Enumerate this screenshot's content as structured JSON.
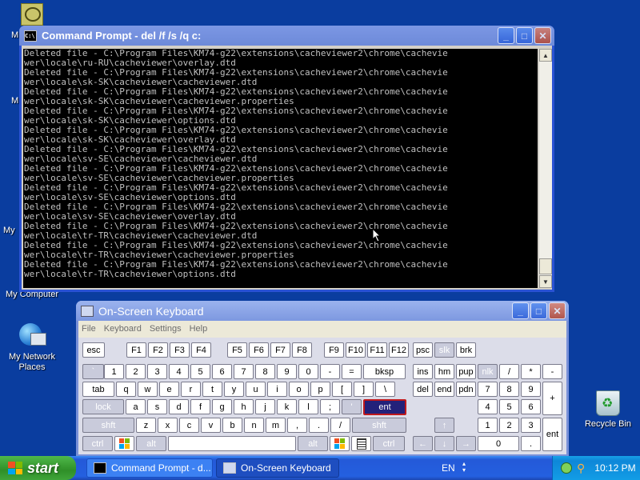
{
  "desktop": {
    "icons": [
      {
        "label": "My Computer"
      },
      {
        "label": "My Network Places"
      },
      {
        "label": "Recycle Bin"
      }
    ],
    "partial_label_1": "M",
    "partial_label_2": "M",
    "partial_label_3": "My"
  },
  "cmd": {
    "title": "Command Prompt - del /f /s /q c:",
    "lines": [
      "Deleted file - C:\\Program Files\\KM74-g22\\extensions\\cacheviewer2\\chrome\\cachevie",
      "wer\\locale\\ru-RU\\cacheviewer\\overlay.dtd",
      "Deleted file - C:\\Program Files\\KM74-g22\\extensions\\cacheviewer2\\chrome\\cachevie",
      "wer\\locale\\sk-SK\\cacheviewer\\cacheviewer.dtd",
      "Deleted file - C:\\Program Files\\KM74-g22\\extensions\\cacheviewer2\\chrome\\cachevie",
      "wer\\locale\\sk-SK\\cacheviewer\\cacheviewer.properties",
      "Deleted file - C:\\Program Files\\KM74-g22\\extensions\\cacheviewer2\\chrome\\cachevie",
      "wer\\locale\\sk-SK\\cacheviewer\\options.dtd",
      "Deleted file - C:\\Program Files\\KM74-g22\\extensions\\cacheviewer2\\chrome\\cachevie",
      "wer\\locale\\sk-SK\\cacheviewer\\overlay.dtd",
      "Deleted file - C:\\Program Files\\KM74-g22\\extensions\\cacheviewer2\\chrome\\cachevie",
      "wer\\locale\\sv-SE\\cacheviewer\\cacheviewer.dtd",
      "Deleted file - C:\\Program Files\\KM74-g22\\extensions\\cacheviewer2\\chrome\\cachevie",
      "wer\\locale\\sv-SE\\cacheviewer\\cacheviewer.properties",
      "Deleted file - C:\\Program Files\\KM74-g22\\extensions\\cacheviewer2\\chrome\\cachevie",
      "wer\\locale\\sv-SE\\cacheviewer\\options.dtd",
      "Deleted file - C:\\Program Files\\KM74-g22\\extensions\\cacheviewer2\\chrome\\cachevie",
      "wer\\locale\\sv-SE\\cacheviewer\\overlay.dtd",
      "Deleted file - C:\\Program Files\\KM74-g22\\extensions\\cacheviewer2\\chrome\\cachevie",
      "wer\\locale\\tr-TR\\cacheviewer\\cacheviewer.dtd",
      "Deleted file - C:\\Program Files\\KM74-g22\\extensions\\cacheviewer2\\chrome\\cachevie",
      "wer\\locale\\tr-TR\\cacheviewer\\cacheviewer.properties",
      "Deleted file - C:\\Program Files\\KM74-g22\\extensions\\cacheviewer2\\chrome\\cachevie",
      "wer\\locale\\tr-TR\\cacheviewer\\options.dtd"
    ],
    "minimize": "_",
    "maximize": "□",
    "close": "✕"
  },
  "osk": {
    "title": "On-Screen Keyboard",
    "menu": [
      "File",
      "Keyboard",
      "Settings",
      "Help"
    ],
    "minimize": "_",
    "maximize": "□",
    "close": "✕",
    "keys": {
      "esc": "esc",
      "f_row": [
        "F1",
        "F2",
        "F3",
        "F4",
        "F5",
        "F6",
        "F7",
        "F8",
        "F9",
        "F10",
        "F11",
        "F12"
      ],
      "psc": "psc",
      "slk": "slk",
      "brk": "brk",
      "num_row": [
        "`",
        "1",
        "2",
        "3",
        "4",
        "5",
        "6",
        "7",
        "8",
        "9",
        "0",
        "-",
        "="
      ],
      "bksp": "bksp",
      "ins": "ins",
      "hm": "hm",
      "pup": "pup",
      "nlk": "nlk",
      "np_div": "/",
      "np_mul": "*",
      "np_sub": "-",
      "tab": "tab",
      "q_row": [
        "q",
        "w",
        "e",
        "r",
        "t",
        "y",
        "u",
        "i",
        "o",
        "p",
        "[",
        "]",
        "\\"
      ],
      "del": "del",
      "end": "end",
      "pdn": "pdn",
      "np7": "7",
      "np8": "8",
      "np9": "9",
      "np_add": "+",
      "lock": "lock",
      "a_row": [
        "a",
        "s",
        "d",
        "f",
        "g",
        "h",
        "j",
        "k",
        "l",
        ";",
        "'"
      ],
      "ent": "ent",
      "np4": "4",
      "np5": "5",
      "np6": "6",
      "shft": "shft",
      "z_row": [
        "z",
        "x",
        "c",
        "v",
        "b",
        "n",
        "m",
        ",",
        ".",
        "/"
      ],
      "up": "↑",
      "np1": "1",
      "np2": "2",
      "np3": "3",
      "np_ent": "ent",
      "ctrl": "ctrl",
      "alt": "alt",
      "left": "←",
      "down": "↓",
      "right": "→",
      "np0": "0",
      "np_dot": "."
    }
  },
  "taskbar": {
    "start": "start",
    "tasks": [
      "Command Prompt - d...",
      "On-Screen Keyboard"
    ],
    "lang": "EN",
    "clock": "10:12 PM"
  }
}
